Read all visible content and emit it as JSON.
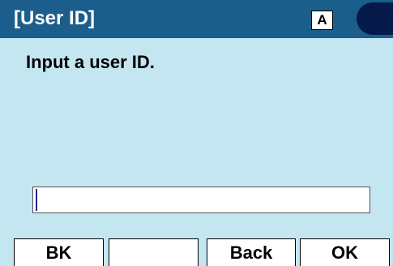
{
  "header": {
    "title": "[User ID]",
    "input_mode": "A"
  },
  "main": {
    "prompt": "Input a user ID.",
    "input": {
      "value": "",
      "placeholder": ""
    }
  },
  "softkeys": [
    {
      "label": "BK"
    },
    {
      "label": ""
    },
    {
      "label": "Back"
    },
    {
      "label": "OK"
    }
  ],
  "colors": {
    "screen_background": "#c4e6f0",
    "header_background": "#1b5e8c",
    "status_indicator": "#061a4a",
    "caret": "#1d2a8a"
  }
}
